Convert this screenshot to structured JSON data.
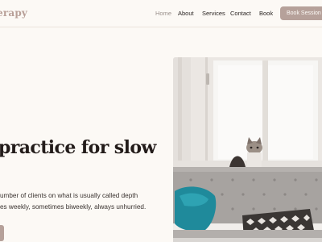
{
  "header": {
    "brand": "erapy",
    "nav": [
      "Home",
      "About",
      "Services",
      "Contact",
      "Book"
    ],
    "cta_label": "Book Session"
  },
  "hero": {
    "headline": "practice for slow",
    "body_lines": [
      "umber of clients on what is usually called depth",
      "es weekly, sometimes biweekly, always unhurried."
    ]
  },
  "colors": {
    "background": "#fcf9f5",
    "brand": "#b89f97",
    "accent": "#b6a19a",
    "text": "#2b2523"
  }
}
